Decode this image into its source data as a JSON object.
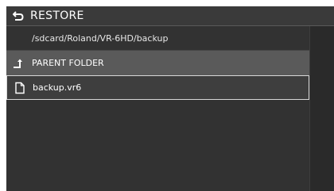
{
  "header": {
    "title": "RESTORE",
    "back_icon": "back-arrow-icon"
  },
  "path": {
    "text": "/sdcard/Roland/VR-6HD/backup"
  },
  "rows": [
    {
      "label": "PARENT FOLDER",
      "icon": "parent-folder-arrow-icon"
    },
    {
      "label": "backup.vr6",
      "icon": "file-icon"
    }
  ],
  "colors": {
    "background": "#2b2b2b",
    "selected_row": "#5a5a5a",
    "focus_border": "#d8d8d8",
    "text": "#ffffff"
  }
}
